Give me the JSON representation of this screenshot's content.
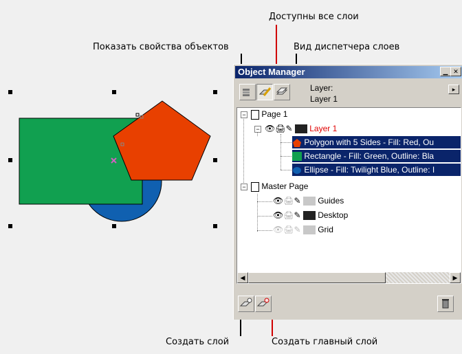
{
  "callouts": {
    "all_layers": "Доступны все слои",
    "show_props": "Показать свойства объектов",
    "manager_view": "Вид диспетчера слоев",
    "new_layer": "Создать слой",
    "new_master_layer": "Создать главный слой"
  },
  "panel": {
    "title": "Object Manager",
    "layer_label": "Layer:",
    "layer_name": "Layer 1"
  },
  "tree": {
    "page1": "Page 1",
    "layer1": "Layer 1",
    "obj_polygon": "Polygon with 5 Sides - Fill: Red, Ou",
    "obj_rect": "Rectangle - Fill: Green, Outline: Bla",
    "obj_ellipse": "Ellipse - Fill: Twilight Blue, Outline: I",
    "master": "Master Page",
    "guides": "Guides",
    "desktop": "Desktop",
    "grid": "Grid"
  },
  "colors": {
    "green": "#11a050",
    "red": "#e84000",
    "blue": "#1060b0",
    "selection": "#0a246a",
    "layer1_text": "#e00000"
  }
}
